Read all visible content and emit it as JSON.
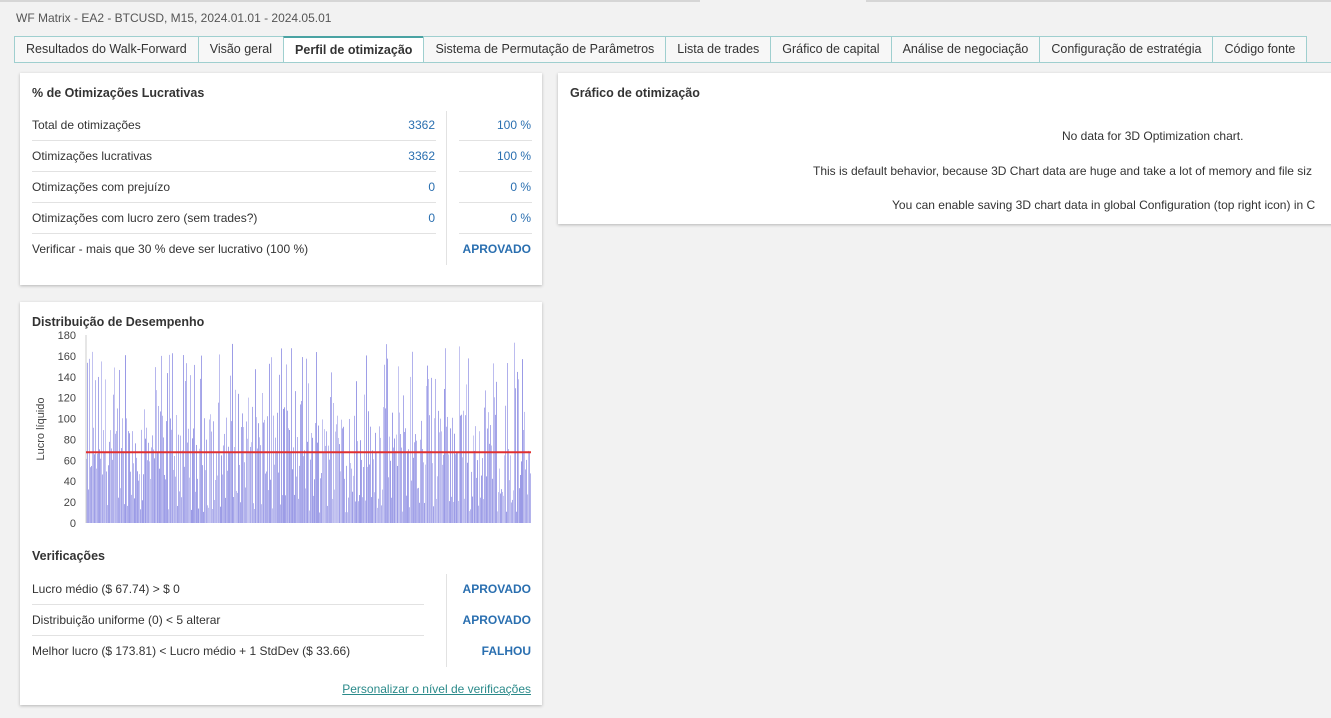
{
  "window": {
    "title": "WF Matrix - EA2 - BTCUSD, M15, 2024.01.01 - 2024.05.01"
  },
  "tabs": [
    {
      "label": "Resultados do Walk-Forward",
      "active": false
    },
    {
      "label": "Visão geral",
      "active": false
    },
    {
      "label": "Perfil de otimização",
      "active": true
    },
    {
      "label": "Sistema de Permutação de Parâmetros",
      "active": false
    },
    {
      "label": "Lista de trades",
      "active": false
    },
    {
      "label": "Gráfico de capital",
      "active": false
    },
    {
      "label": "Análise de negociação",
      "active": false
    },
    {
      "label": "Configuração de estratégia",
      "active": false
    },
    {
      "label": "Código fonte",
      "active": false
    }
  ],
  "profitable": {
    "title": "% de Otimizações Lucrativas",
    "rows": [
      {
        "label": "Total de otimizações",
        "count": "3362",
        "pct": "100 %"
      },
      {
        "label": "Otimizações lucrativas",
        "count": "3362",
        "pct": "100 %"
      },
      {
        "label": "Otimizações com prejuízo",
        "count": "0",
        "pct": "0 %"
      },
      {
        "label": "Otimizações com lucro zero (sem trades?)",
        "count": "0",
        "pct": "0 %"
      }
    ],
    "check": {
      "label": "Verificar - mais que 30 % deve ser lucrativo (100 %)",
      "result": "APROVADO"
    }
  },
  "distribution": {
    "title": "Distribuição de Desempenho",
    "checks_title": "Verificações",
    "checks": [
      {
        "label": "Lucro médio ($ 67.74) > $ 0",
        "result": "APROVADO",
        "status": "pass"
      },
      {
        "label": "Distribuição uniforme (0) < 5 alterar",
        "result": "APROVADO",
        "status": "pass"
      },
      {
        "label": "Melhor lucro ($ 173.81) < Lucro médio + 1 StdDev ($ 33.66)",
        "result": "FALHOU",
        "status": "fail"
      }
    ],
    "link": "Personalizar o nível de verificações"
  },
  "chart_data": {
    "type": "bar",
    "title": "",
    "xlabel": "",
    "ylabel": "Lucro líquido",
    "ylim": [
      0,
      180
    ],
    "yticks": [
      0,
      20,
      40,
      60,
      80,
      100,
      120,
      140,
      160,
      180
    ],
    "reference_line": 67.74,
    "n_points": 3362,
    "value_range": [
      0,
      173.81
    ],
    "bar_color": "#9a9ae6",
    "line_color": "#e03030"
  },
  "optimization_chart": {
    "title": "Gráfico de otimização",
    "messages": [
      "No data for 3D Optimization chart.",
      "This is default behavior, because 3D Chart data are huge and take a lot of memory and file siz",
      "You can enable saving 3D chart data in global Configuration (top right icon) in C"
    ]
  }
}
